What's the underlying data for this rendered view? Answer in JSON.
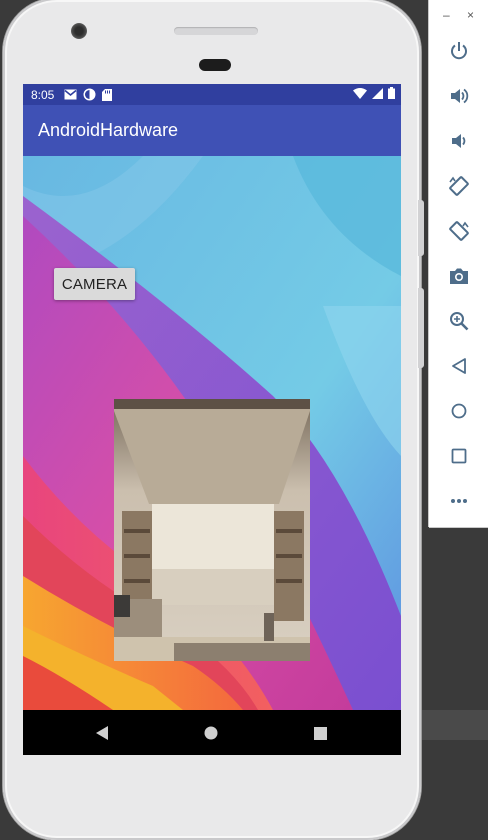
{
  "status_bar": {
    "time": "8:05",
    "icons": [
      "gmail-icon",
      "sync-icon",
      "sd-card-icon"
    ],
    "right_icons": [
      "wifi-icon",
      "signal-icon",
      "battery-icon"
    ]
  },
  "app_bar": {
    "title": "AndroidHardware"
  },
  "content": {
    "camera_button_label": "CAMERA"
  },
  "navigation": {
    "buttons": [
      "back-icon",
      "home-icon",
      "recents-icon"
    ]
  },
  "emulator_panel": {
    "window_controls": {
      "minimize": "–",
      "close": "×"
    },
    "tools": [
      "power-icon",
      "volume-up-icon",
      "volume-down-icon",
      "rotate-left-icon",
      "rotate-right-icon",
      "screenshot-icon",
      "zoom-icon",
      "back-icon",
      "home-icon",
      "overview-icon",
      "more-icon"
    ]
  },
  "colors": {
    "status_bar": "#303f9f",
    "app_bar": "#3f51b5",
    "panel_icon": "#4e6d8a"
  }
}
